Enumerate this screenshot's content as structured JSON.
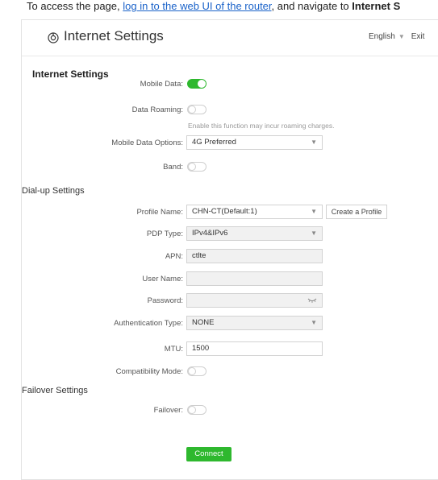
{
  "intro": {
    "prefix": "To access the page, ",
    "link": "log in to the web UI of the router",
    "middle": ", and navigate to ",
    "bold": "Internet S"
  },
  "header": {
    "title": "Internet Settings",
    "language": "English",
    "exit": "Exit"
  },
  "internet_settings": {
    "title": "Internet Settings",
    "mobile_data_label": "Mobile Data:",
    "mobile_data_on": true,
    "data_roaming_label": "Data Roaming:",
    "data_roaming_on": false,
    "roaming_hint": "Enable this function may incur roaming charges.",
    "mobile_data_options_label": "Mobile Data Options:",
    "mobile_data_options_value": "4G Preferred",
    "band_label": "Band:",
    "band_on": false
  },
  "dialup_settings": {
    "title": "Dial-up Settings",
    "profile_name_label": "Profile Name:",
    "profile_name_value": "CHN-CT(Default:1)",
    "create_profile_button": "Create a Profile",
    "pdp_type_label": "PDP Type:",
    "pdp_type_value": "IPv4&IPv6",
    "apn_label": "APN:",
    "apn_value": "ctlte",
    "user_name_label": "User Name:",
    "user_name_value": "",
    "password_label": "Password:",
    "password_value": "",
    "auth_type_label": "Authentication Type:",
    "auth_type_value": "NONE",
    "mtu_label": "MTU:",
    "mtu_value": "1500",
    "compat_mode_label": "Compatibility Mode:",
    "compat_mode_on": false
  },
  "failover_settings": {
    "title": "Failover Settings",
    "failover_label": "Failover:",
    "failover_on": false
  },
  "connect_button": "Connect",
  "colors": {
    "accent": "#2eb82e",
    "link": "#1a62c9"
  }
}
